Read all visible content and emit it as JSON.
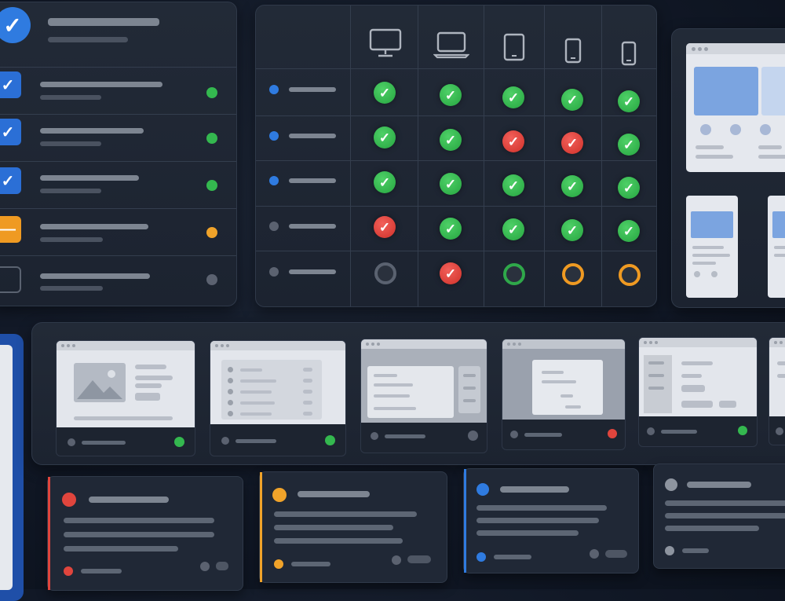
{
  "colors": {
    "background": "#111826",
    "panel": "#1f2633",
    "success": "#34b84f",
    "error": "#e0453d",
    "warning": "#f0a32a",
    "neutral": "#5b6270",
    "accent": "#2f7be0"
  },
  "checklist": {
    "header_icon": "check-circle-icon",
    "rows": [
      {
        "checkbox": "checked",
        "status": "green"
      },
      {
        "checkbox": "checked",
        "status": "green"
      },
      {
        "checkbox": "checked",
        "status": "green"
      },
      {
        "checkbox": "indeterminate",
        "status": "orange"
      },
      {
        "checkbox": "unchecked",
        "status": "gray"
      }
    ]
  },
  "matrix": {
    "devices": [
      "desktop-monitor-icon",
      "laptop-icon",
      "tablet-icon",
      "tablet-small-icon",
      "phone-icon"
    ],
    "rows": [
      {
        "dot": "blue",
        "cells": [
          "pass",
          "pass",
          "pass",
          "pass",
          "pass"
        ]
      },
      {
        "dot": "blue",
        "cells": [
          "pass",
          "pass",
          "fail",
          "fail",
          "pass"
        ]
      },
      {
        "dot": "blue",
        "cells": [
          "pass",
          "pass",
          "pass",
          "pass",
          "pass"
        ]
      },
      {
        "dot": "gray",
        "cells": [
          "fail",
          "pass",
          "pass",
          "pass",
          "pass"
        ]
      },
      {
        "dot": "gray",
        "cells": [
          "pending-gray",
          "fail",
          "pending-green",
          "pending-orange",
          "pending-orange"
        ]
      }
    ]
  },
  "layout_previews": {
    "desktop": "desktop-layout-preview",
    "mobile": [
      "mobile-layout-preview",
      "mobile-layout-preview"
    ]
  },
  "thumbnails": [
    {
      "kind": "image-card",
      "status": "green"
    },
    {
      "kind": "list",
      "status": "green"
    },
    {
      "kind": "modal-sidebar",
      "status": "gray"
    },
    {
      "kind": "modal-overlay",
      "status": "red"
    },
    {
      "kind": "form",
      "status": "green"
    },
    {
      "kind": "partial",
      "status": "none"
    }
  ],
  "issue_cards": [
    {
      "severity": "red",
      "accent": "#e0453d"
    },
    {
      "severity": "orange",
      "accent": "#f0a32a"
    },
    {
      "severity": "blue",
      "accent": "#2f7be0"
    },
    {
      "severity": "gray",
      "accent": "none"
    }
  ]
}
